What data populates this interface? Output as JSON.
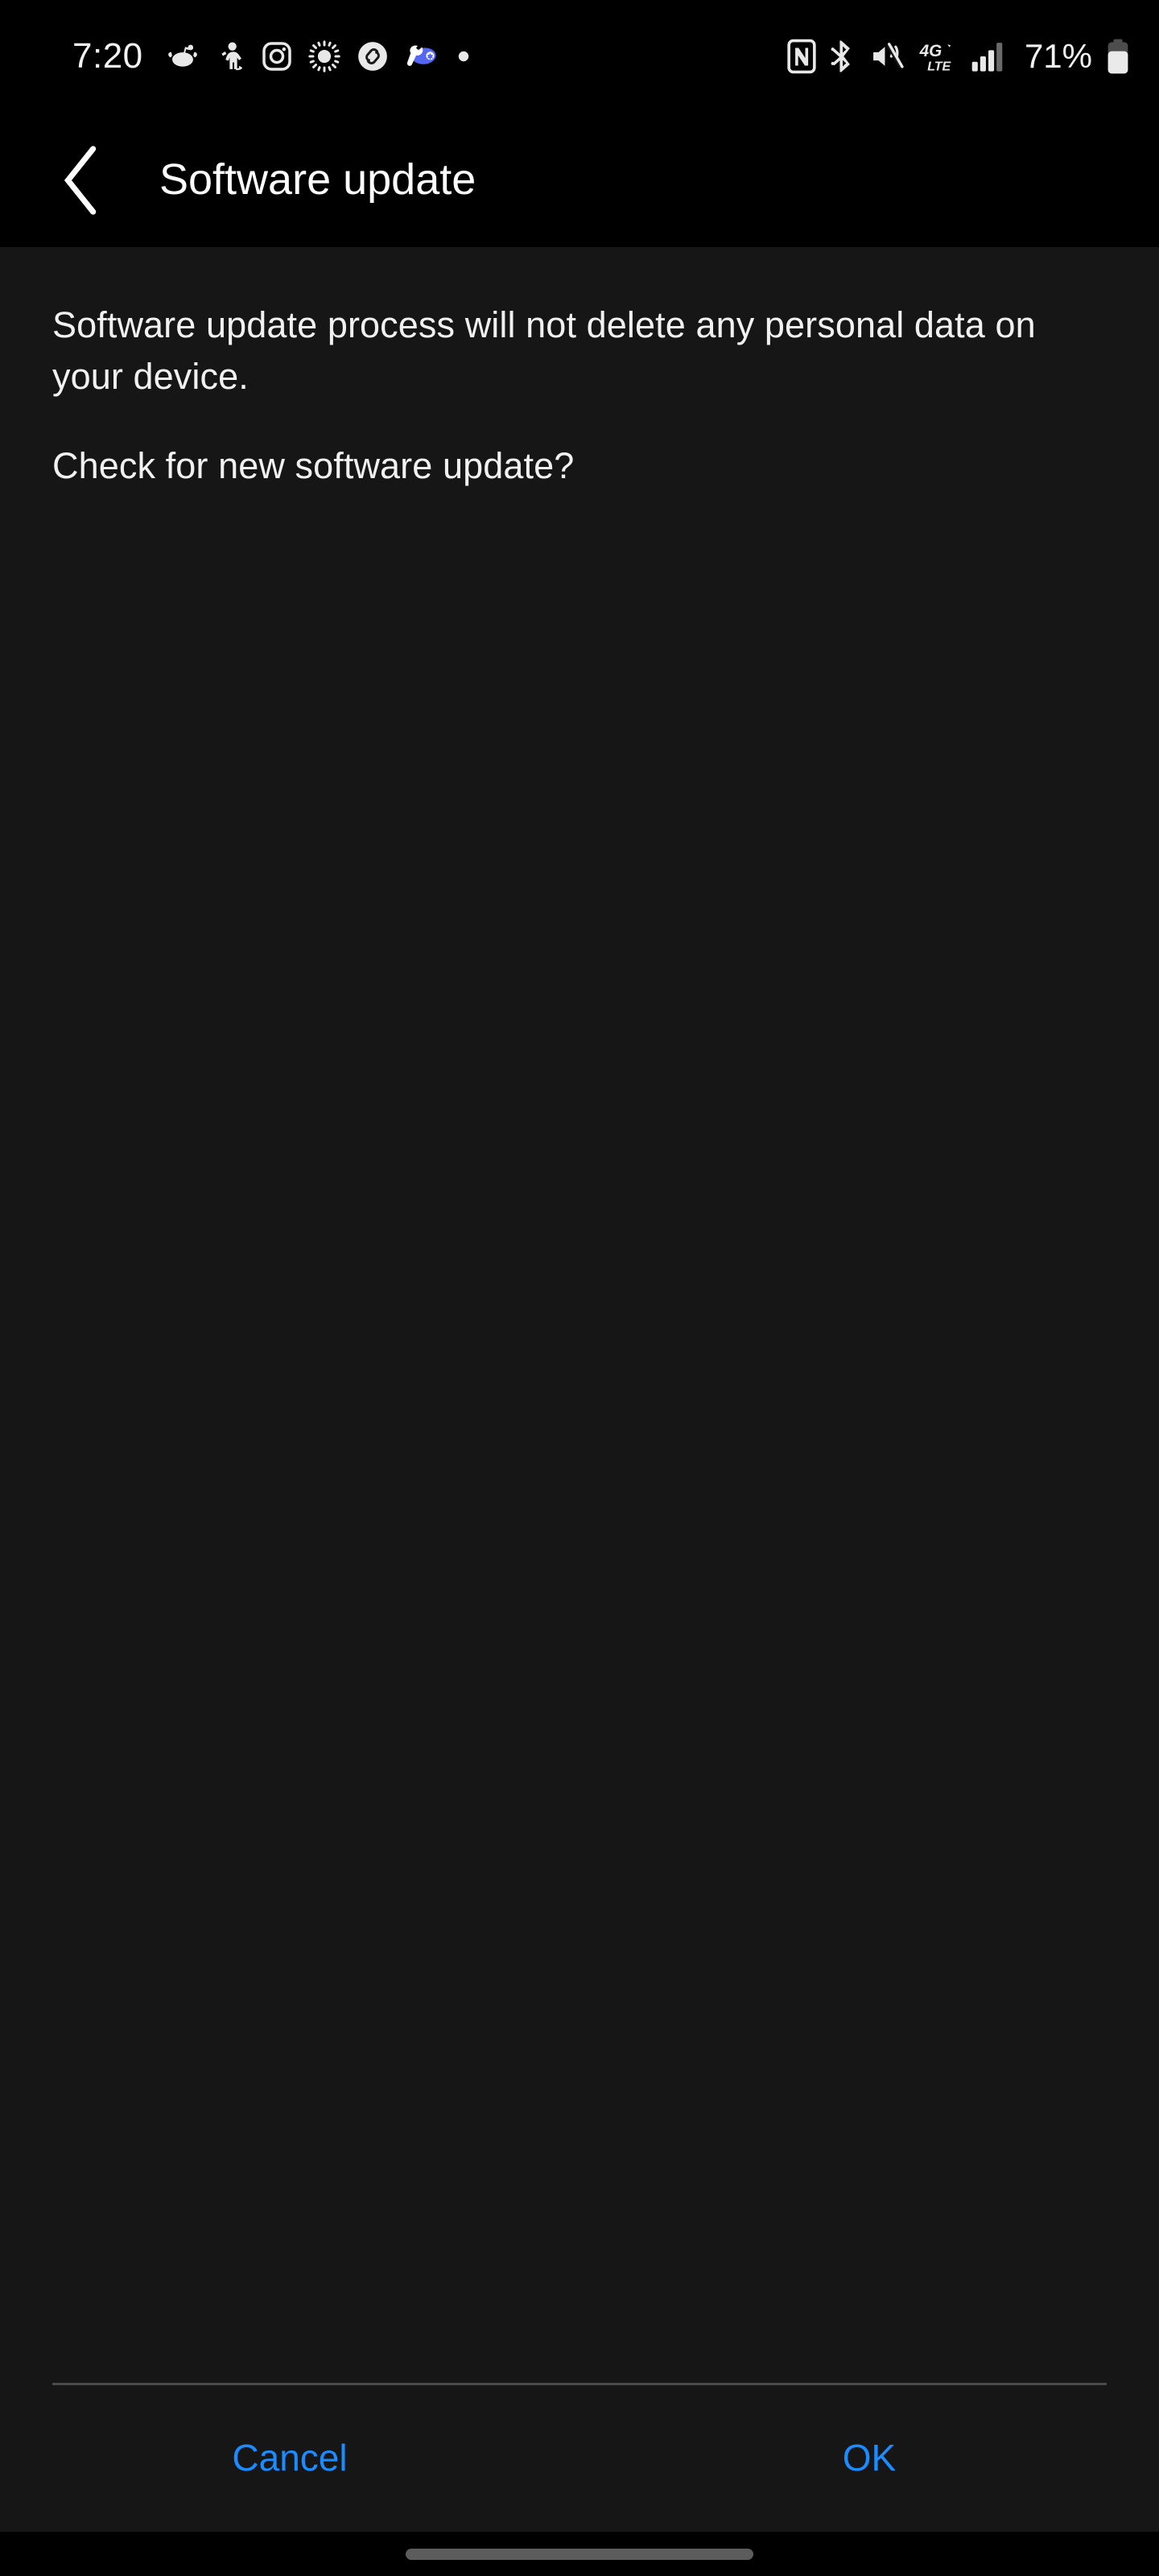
{
  "status_bar": {
    "clock": "7:20",
    "battery_percent": "71%",
    "network_label": "4G",
    "network_sublabel": "LTE",
    "notification_icons": [
      {
        "name": "reddit-icon",
        "label": "Reddit"
      },
      {
        "name": "person-activity-icon",
        "label": "Activity"
      },
      {
        "name": "instagram-icon",
        "label": "Instagram"
      },
      {
        "name": "brightness-sun-icon",
        "label": "Brightness"
      },
      {
        "name": "shazam-icon",
        "label": "Shazam"
      },
      {
        "name": "tools-wrench-icon",
        "label": "Device care"
      },
      {
        "name": "more-notifications-dot-icon",
        "label": "More"
      }
    ],
    "system_icons": [
      {
        "name": "nfc-icon",
        "label": "NFC"
      },
      {
        "name": "bluetooth-icon",
        "label": "Bluetooth"
      },
      {
        "name": "mute-vibrate-icon",
        "label": "Sound off / vibrate"
      },
      {
        "name": "network-4g-lte-icon",
        "label": "4G LTE"
      },
      {
        "name": "signal-bars-icon",
        "label": "Signal strength"
      },
      {
        "name": "battery-icon",
        "label": "Battery"
      }
    ]
  },
  "app_bar": {
    "back_label": "Back",
    "title": "Software update"
  },
  "content": {
    "paragraph_1": "Software update process will not delete any personal data on your device.",
    "paragraph_2": "Check for new software update?"
  },
  "footer": {
    "cancel_label": "Cancel",
    "ok_label": "OK"
  },
  "nav_bar": {
    "home_handle_label": "Home gesture handle"
  },
  "colors": {
    "status_bar_bg": "#000000",
    "app_bar_bg": "#000000",
    "content_bg": "#161616",
    "primary_text": "#f1f1f1",
    "accent_blue": "#1a8cff",
    "divider": "#4a4a4a",
    "nav_pill": "#5c5c5c"
  }
}
